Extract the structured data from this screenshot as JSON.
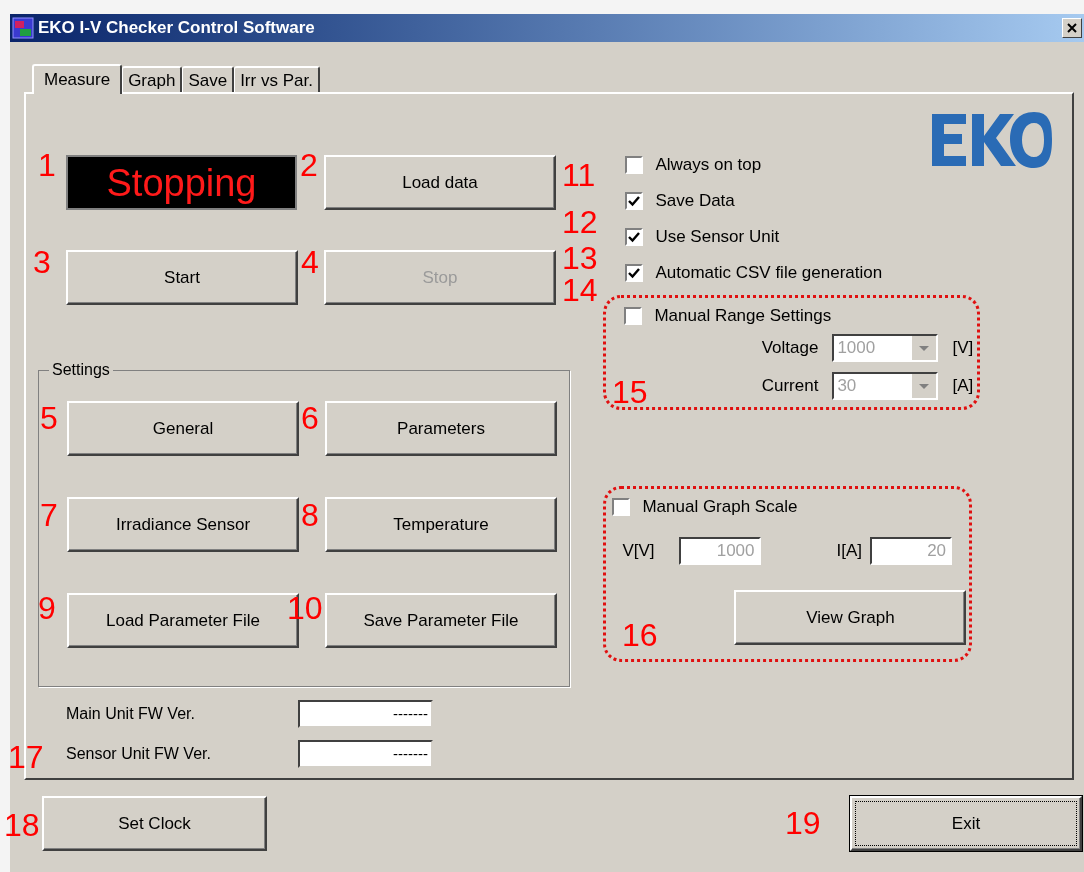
{
  "window": {
    "title": "EKO I-V Checker Control Software"
  },
  "tabs": [
    {
      "label": "Measure",
      "selected": true
    },
    {
      "label": "Graph",
      "selected": false
    },
    {
      "label": "Save",
      "selected": false
    },
    {
      "label": "Irr vs Par.",
      "selected": false
    }
  ],
  "status_display": {
    "text": "Stopping"
  },
  "load_button": {
    "label": "Load data"
  },
  "run_buttons": [
    {
      "label": "Start",
      "disabled": false
    },
    {
      "label": "Stop",
      "disabled": true
    }
  ],
  "settings": {
    "title": "Settings",
    "buttons": [
      {
        "label": "General"
      },
      {
        "label": "Parameters"
      },
      {
        "label": "Irradiance Sensor"
      },
      {
        "label": "Temperature"
      },
      {
        "label": "Load Parameter File"
      },
      {
        "label": "Save Parameter File"
      }
    ]
  },
  "firmware": [
    {
      "label": "Main Unit FW Ver.",
      "value": "-------"
    },
    {
      "label": "Sensor Unit FW Ver.",
      "value": "-------"
    }
  ],
  "options": [
    {
      "label": "Always on top",
      "checked": false
    },
    {
      "label": "Save Data",
      "checked": true
    },
    {
      "label": "Use Sensor Unit",
      "checked": true
    },
    {
      "label": "Automatic CSV file generation",
      "checked": true
    }
  ],
  "manual_range": {
    "label": "Manual Range Settings",
    "checked": false,
    "fields": [
      {
        "label": "Voltage",
        "value": "1000",
        "unit": "[V]"
      },
      {
        "label": "Current",
        "value": "30",
        "unit": "[A]"
      }
    ]
  },
  "manual_graph_scale": {
    "label": "Manual Graph Scale",
    "checked": false,
    "fields": [
      {
        "label": "V[V]",
        "value": "1000"
      },
      {
        "label": "I[A]",
        "value": "20"
      }
    ],
    "button": "View Graph"
  },
  "set_clock_button": "Set Clock",
  "exit_button": "Exit",
  "callouts": [
    "1",
    "2",
    "3",
    "4",
    "5",
    "6",
    "7",
    "8",
    "9",
    "10",
    "11",
    "12",
    "13",
    "14",
    "15",
    "16",
    "17",
    "18",
    "19"
  ]
}
